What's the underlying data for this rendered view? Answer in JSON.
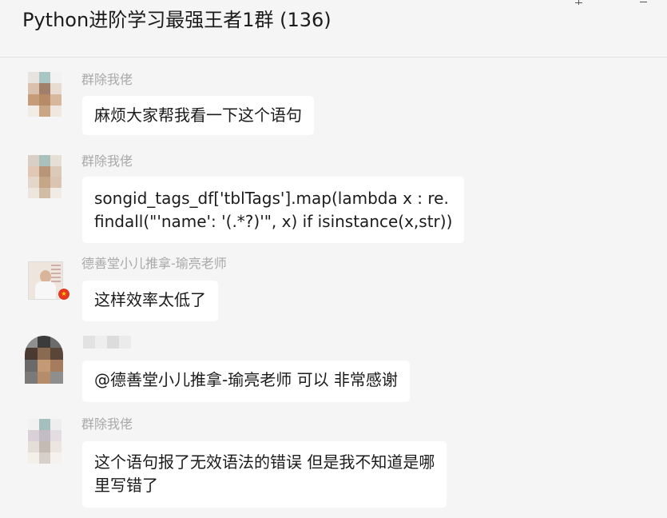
{
  "window": {
    "title": "Python进阶学习最强王者1群 (136)",
    "pin_icon": "pin-icon",
    "minimize_icon": "minimize-icon"
  },
  "messages": [
    {
      "sender": "群除我佬",
      "text_lines": [
        "麻烦大家帮我看一下这个语句"
      ]
    },
    {
      "sender": "群除我佬",
      "text_lines": [
        "songid_tags_df['tblTags'].map(lambda x : re.",
        "findall(\"'name': '(.*?)'\", x) if isinstance(x,str))"
      ]
    },
    {
      "sender": "德善堂小儿推拿-瑜亮老师",
      "text_lines": [
        "这样效率太低了"
      ]
    },
    {
      "sender": "",
      "text_lines": [
        "@德善堂小儿推拿-瑜亮老师 可以 非常感谢"
      ]
    },
    {
      "sender": "群除我佬",
      "text_lines": [
        "这个语句报了无效语法的错误 但是我不知道是哪",
        "里写错了"
      ]
    }
  ]
}
